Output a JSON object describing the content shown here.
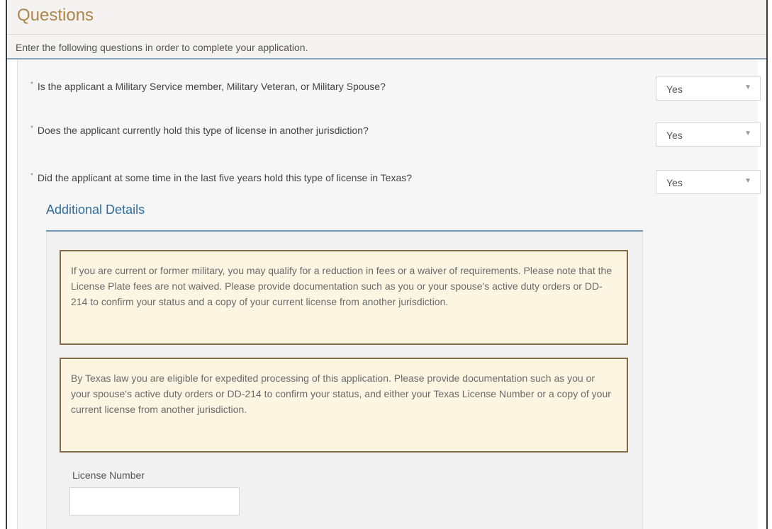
{
  "header": {
    "title": "Questions",
    "subtitle": "Enter the following questions in order to complete your application."
  },
  "questions": [
    {
      "required_mark": "*",
      "text": "Is the applicant a Military Service member, Military Veteran, or Military Spouse?",
      "answer": "Yes"
    },
    {
      "required_mark": "*",
      "text": "Does the applicant currently hold this type of license in another jurisdiction?",
      "answer": "Yes"
    },
    {
      "required_mark": "*",
      "text": "Did the applicant at some time in the last five years hold this type of license in Texas?",
      "answer": "Yes"
    }
  ],
  "details": {
    "title": "Additional Details",
    "notices": [
      "If you are current or former military, you may qualify for a reduction in fees or a waiver of requirements. Please note that the License Plate fees are not waived. Please provide documentation such as you or your spouse's active duty orders or DD-214 to confirm your status and a copy of your current license from another jurisdiction.",
      "By Texas law you are eligible for expedited processing of this application. Please provide documentation such as you or your spouse's active duty orders or DD-214 to confirm your status, and either your Texas License Number or a copy of your current license from another jurisdiction."
    ],
    "license_number": {
      "label": "License Number",
      "value": ""
    }
  },
  "icons": {
    "dropdown": "chevron-down-icon"
  },
  "colors": {
    "title": "#b0854a",
    "details_title": "#2f6d9e",
    "notice_bg": "#fcf5e2",
    "notice_border": "#866a43"
  }
}
